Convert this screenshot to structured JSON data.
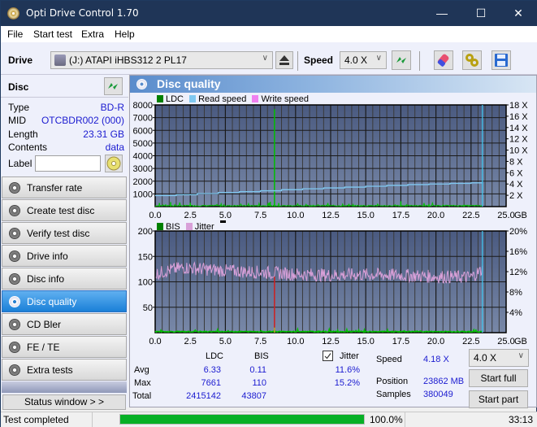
{
  "window": {
    "title": "Opti Drive Control 1.70",
    "minimize": "—",
    "maximize": "☐",
    "close": "✕"
  },
  "menu": [
    "File",
    "Start test",
    "Extra",
    "Help"
  ],
  "toolbar": {
    "drive_label": "Drive",
    "drive_value": "(J:)  ATAPI iHBS312   2 PL17",
    "speed_label": "Speed",
    "speed_value": "4.0 X"
  },
  "disc": {
    "header": "Disc",
    "rows": [
      {
        "key": "Type",
        "value": "BD-R"
      },
      {
        "key": "MID",
        "value": "OTCBDR002 (000)"
      },
      {
        "key": "Length",
        "value": "23.31 GB"
      },
      {
        "key": "Contents",
        "value": "data"
      }
    ],
    "label_key": "Label",
    "label_value": ""
  },
  "nav": [
    {
      "label": "Transfer rate",
      "active": false
    },
    {
      "label": "Create test disc",
      "active": false
    },
    {
      "label": "Verify test disc",
      "active": false
    },
    {
      "label": "Drive info",
      "active": false
    },
    {
      "label": "Disc info",
      "active": false
    },
    {
      "label": "Disc quality",
      "active": true
    },
    {
      "label": "CD Bler",
      "active": false
    },
    {
      "label": "FE / TE",
      "active": false
    },
    {
      "label": "Extra tests",
      "active": false
    }
  ],
  "status_window_button": "Status window > >",
  "panel_title": "Disc quality",
  "colors": {
    "plot_bg_top": "#4a5a80",
    "plot_bg_bottom": "#7888a8",
    "ldc": "#00c000",
    "read_speed": "#80c8f0",
    "write_speed": "#f080f0",
    "bis": "#00c000",
    "jitter": "#d8a0d8",
    "marker": "#40c8f0",
    "value_blue": "#1b1bd0",
    "progress": "#06b025"
  },
  "chart_data": [
    {
      "type": "line",
      "title": "LDC / Read speed",
      "legend": [
        "LDC",
        "Read speed",
        "Write speed"
      ],
      "xlabel": "GB",
      "x_ticks": [
        "0.0",
        "2.5",
        "5.0",
        "7.5",
        "10.0",
        "12.5",
        "15.0",
        "17.5",
        "20.0",
        "22.5",
        "25.0"
      ],
      "xlim": [
        0,
        25
      ],
      "ylim_left": [
        0,
        8000
      ],
      "y_ticks_left": [
        "8000",
        "7000",
        "6000",
        "5000",
        "4000",
        "3000",
        "2000",
        "1000"
      ],
      "ylim_right": [
        0,
        18
      ],
      "y_ticks_right": [
        "18 X",
        "16 X",
        "14 X",
        "12 X",
        "10 X",
        "8 X",
        "6 X",
        "4 X",
        "2 X"
      ],
      "grid": true,
      "marker_x": 23.31,
      "series": [
        {
          "name": "Read speed",
          "axis": "right",
          "x": [
            0,
            1.5,
            3,
            4.5,
            6,
            7.5,
            9,
            10.5,
            12,
            13.5,
            15,
            16.5,
            18,
            19.5,
            21,
            22.5,
            23.31
          ],
          "y": [
            1.95,
            2.1,
            2.3,
            2.5,
            2.65,
            2.8,
            3.0,
            3.15,
            3.3,
            3.45,
            3.6,
            3.75,
            3.9,
            4.0,
            4.1,
            4.2,
            4.2
          ]
        },
        {
          "name": "LDC",
          "axis": "left",
          "spikes": [
            {
              "x": 8.5,
              "y": 7661
            }
          ],
          "baseline": [
            {
              "x": 0.3,
              "y": 280
            },
            {
              "x": 1.1,
              "y": 350
            },
            {
              "x": 2.5,
              "y": 300
            },
            {
              "x": 8.2,
              "y": 380
            },
            {
              "x": 8.8,
              "y": 280
            },
            {
              "x": 13.8,
              "y": 220
            },
            {
              "x": 17.5,
              "y": 420
            },
            {
              "x": 19.5,
              "y": 200
            },
            {
              "x": 22.0,
              "y": 150
            }
          ]
        }
      ]
    },
    {
      "type": "line",
      "title": "BIS / Jitter",
      "legend": [
        "BIS",
        "Jitter"
      ],
      "xlabel": "GB",
      "x_ticks": [
        "0.0",
        "2.5",
        "5.0",
        "7.5",
        "10.0",
        "12.5",
        "15.0",
        "17.5",
        "20.0",
        "22.5",
        "25.0"
      ],
      "xlim": [
        0,
        25
      ],
      "ylim_left": [
        0,
        200
      ],
      "y_ticks_left": [
        "200",
        "150",
        "100",
        "50"
      ],
      "ylim_right": [
        0,
        20
      ],
      "y_ticks_right": [
        "20%",
        "16%",
        "12%",
        "8%",
        "4%"
      ],
      "grid": true,
      "marker_x": 23.31,
      "series": [
        {
          "name": "Jitter",
          "axis": "right",
          "mean_profile": {
            "x": [
              0,
              1,
              2,
              3,
              5,
              7.5,
              10,
              12.5,
              15,
              17.5,
              20,
              22.5,
              23.3
            ],
            "y": [
              11.5,
              12.3,
              12.8,
              12.6,
              12.2,
              11.9,
              11.5,
              11.3,
              11.4,
              11.3,
              11.0,
              10.9,
              12.4
            ]
          },
          "noise": 1.3
        },
        {
          "name": "BIS",
          "axis": "left",
          "spikes": [
            {
              "x": 8.5,
              "y": 110
            }
          ],
          "baseline_level": 2
        }
      ]
    }
  ],
  "stats": {
    "col_ldc": "LDC",
    "col_bis": "BIS",
    "jitter_label": "Jitter",
    "jitter_checked": true,
    "rows": [
      {
        "label": "Avg",
        "ldc": "6.33",
        "bis": "0.11",
        "jitter": "11.6%"
      },
      {
        "label": "Max",
        "ldc": "7661",
        "bis": "110",
        "jitter": "15.2%"
      },
      {
        "label": "Total",
        "ldc": "2415142",
        "bis": "43807",
        "jitter": ""
      }
    ],
    "speed_label": "Speed",
    "speed_value": "4.18 X",
    "position_label": "Position",
    "position_value": "23862 MB",
    "samples_label": "Samples",
    "samples_value": "380049",
    "speed_select": "4.0 X",
    "start_full": "Start full",
    "start_part": "Start part"
  },
  "status": {
    "text": "Test completed",
    "progress_percent": 100.0,
    "progress_label": "100.0%",
    "elapsed": "33:13"
  }
}
